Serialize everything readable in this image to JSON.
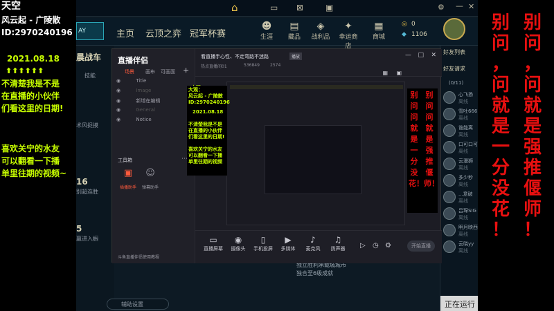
{
  "overlay_left": {
    "logo": "天空",
    "line1": "风云起 - 广陵散",
    "line2": "ID:2970240196",
    "date": "2021.08.18",
    "arrows": "⬆⬆⬆⬆⬆⬆",
    "msg1": "不清楚我是不是",
    "msg2": "在直播的小伙伴",
    "msg3": "们看这里的日期!",
    "msg4": "喜欢关宁的水友",
    "msg5": "可以翻看一下播",
    "msg6": "单里往期的视频~"
  },
  "overlay_right": {
    "col1": [
      "别",
      "问",
      "，",
      "问",
      "就",
      "是",
      "一",
      "分",
      "没",
      "花",
      "！"
    ],
    "col2": [
      "别",
      "问",
      "，",
      "问",
      "就",
      "是",
      "强",
      "推",
      "偃",
      "师",
      "！"
    ]
  },
  "client": {
    "nav_links": [
      "主页",
      "云顶之弈",
      "冠军杯赛"
    ],
    "nav_icons": [
      {
        "name": "生涯",
        "icon": "person-icon"
      },
      {
        "name": "藏品",
        "icon": "collection-icon"
      },
      {
        "name": "战利品",
        "icon": "loot-icon"
      },
      {
        "name": "幸运商店",
        "icon": "lucky-shop-icon"
      },
      {
        "name": "商城",
        "icon": "store-icon"
      }
    ],
    "currency1": "0",
    "currency2": "1106",
    "friends_header": "好友列表",
    "friends_requests": "好友请求",
    "friends_count": "(0/11)",
    "friends": [
      {
        "name": "心飞扬",
        "status": "离线"
      },
      {
        "name": "雪吐666",
        "status": "离线"
      },
      {
        "name": "谁能离",
        "status": "离线"
      },
      {
        "name": "口可口可",
        "status": "离线"
      },
      {
        "name": "云漫狮",
        "status": "离线"
      },
      {
        "name": "多少秒",
        "status": "离线"
      },
      {
        "name": "...意破",
        "status": "离线"
      },
      {
        "name": "吕琛SIG",
        "status": "离线"
      },
      {
        "name": "明月映西",
        "status": "离线"
      },
      {
        "name": "云晓yy",
        "status": "离线"
      }
    ],
    "left_title": "晨战车",
    "left_small1": "技能",
    "left_small2": "术风捉摸",
    "left_num1": "16",
    "left_small3": "别超连胜",
    "left_num2": "5",
    "left_small4": "赢进入橱",
    "bottom_text1": "独立胜利承载城城市",
    "bottom_text2": "独合至6级成就",
    "assist_btn": "辅助设置",
    "running_text": "正在运行"
  },
  "app": {
    "logo": "直播伴侣",
    "tabs": [
      "场景",
      "画布",
      "可画面"
    ],
    "scenes": [
      "Title",
      "Image",
      "新增在编辑",
      "General",
      "Notice"
    ],
    "toolbox": "工具箱",
    "tool1": "插播助手",
    "tool2": "弹幕助手",
    "top_title": "看直播手心性、不走弯路不迷路",
    "top_badge": "播放",
    "top_meta1": "热点直播间01",
    "top_meta2": "536849",
    "top_meta3": "2574",
    "footer_note": "斗鱼直播伴侣使用教程",
    "tools": [
      "直播屏幕",
      "摄像头",
      "手机投屏",
      "多媒体",
      "麦克风",
      "扬声器"
    ],
    "start_btn": "开始直播"
  },
  "inner_overlay": {
    "l1": "大观：",
    "l2": "风云起 - 广陵散",
    "l3": "ID:2970240196",
    "l4": "2021.08.18",
    "l5": "不清楚我是不是",
    "l6": "在直播的小伙伴",
    "l7": "们看这里的日期!",
    "l8": "喜欢关宁的水友",
    "l9": "可以翻看一下播",
    "l10": "单里往期的视频",
    "r1": "别问问就是一分没花！",
    "r2": "别问问就是强推偃师！"
  },
  "colors": {
    "lime": "#c8ff00",
    "red": "#e81010",
    "gold": "#d7d2b4"
  }
}
